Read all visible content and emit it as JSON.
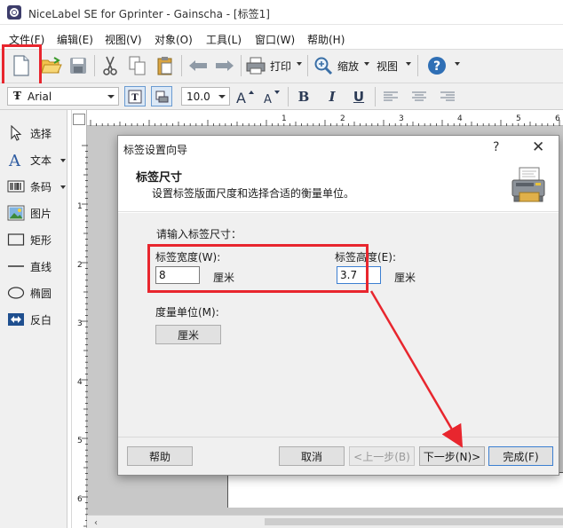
{
  "window": {
    "title": "NiceLabel SE for Gprinter - Gainscha - [标签1]"
  },
  "menu": [
    {
      "label": "文件(F)"
    },
    {
      "label": "编辑(E)"
    },
    {
      "label": "视图(V)"
    },
    {
      "label": "对象(O)"
    },
    {
      "label": "工具(L)"
    },
    {
      "label": "窗口(W)"
    },
    {
      "label": "帮助(H)"
    }
  ],
  "toolbar": {
    "print_label": "打印",
    "zoom_label": "缩放",
    "view_label": "视图"
  },
  "format_toolbar": {
    "font_name": "Arial",
    "font_size": "10.0",
    "bold": "B",
    "italic": "I",
    "underline": "U"
  },
  "tools": [
    {
      "label": "选择",
      "icon": "select-arrow-icon"
    },
    {
      "label": "文本",
      "icon": "text-icon"
    },
    {
      "label": "条码",
      "icon": "barcode-icon"
    },
    {
      "label": "图片",
      "icon": "picture-icon"
    },
    {
      "label": "矩形",
      "icon": "rectangle-icon"
    },
    {
      "label": "直线",
      "icon": "line-icon"
    },
    {
      "label": "椭圆",
      "icon": "ellipse-icon"
    },
    {
      "label": "反白",
      "icon": "inverse-icon"
    }
  ],
  "rulers": {
    "horizontal": [
      "1",
      "2",
      "3",
      "4",
      "5",
      "6"
    ],
    "vertical": [
      "1",
      "2",
      "3",
      "4",
      "5",
      "6"
    ]
  },
  "dialog": {
    "title": "标签设置向导",
    "help_glyph": "?",
    "close_glyph": "✕",
    "heading": "标签尺寸",
    "subheading": "设置标签版面尺度和选择合适的衡量单位。",
    "prompt": "请输入标签尺寸：",
    "width_label": "标签宽度(W):",
    "width_value": "8",
    "width_unit": "厘米",
    "height_label": "标签高度(E):",
    "height_value": "3.7",
    "height_unit": "厘米",
    "unit_label": "度量单位(M):",
    "unit_button": "厘米",
    "buttons": {
      "help": "帮助",
      "cancel": "取消",
      "back": "<上一步(B)",
      "next": "下一步(N)>",
      "finish": "完成(F)"
    }
  },
  "colors": {
    "highlight_red": "#e8262e",
    "focus_blue": "#3c7fd1"
  }
}
